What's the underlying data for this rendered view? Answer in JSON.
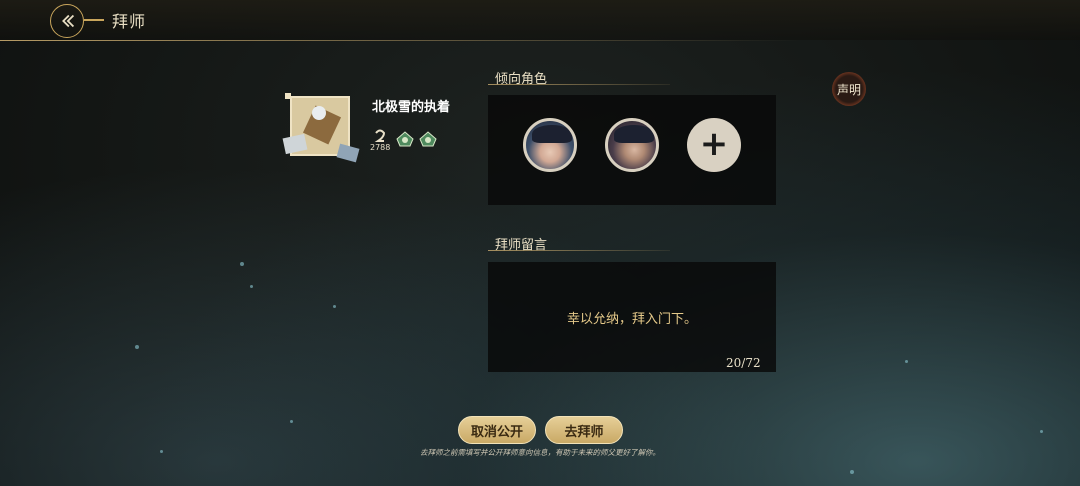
{
  "header": {
    "title": "拜师"
  },
  "profile": {
    "name": "北极雪的执着",
    "level": "2788"
  },
  "stamp": {
    "label": "声明"
  },
  "preferred_roles": {
    "title": "倾向角色",
    "add_symbol": "+"
  },
  "message_section": {
    "title": "拜师留言",
    "message": "幸以允纳，拜入门下。",
    "counter": "20/72"
  },
  "buttons": {
    "cancel_public": "取消公开",
    "go_apprentice": "去拜师"
  },
  "note": "去拜师之前需填写并公开拜师意向信息，有助于未来的师父更好了解你。",
  "colors": {
    "accent_gold": "#c9a65c",
    "button_gold": "#e6cf98",
    "message_text": "#e5c98a"
  }
}
